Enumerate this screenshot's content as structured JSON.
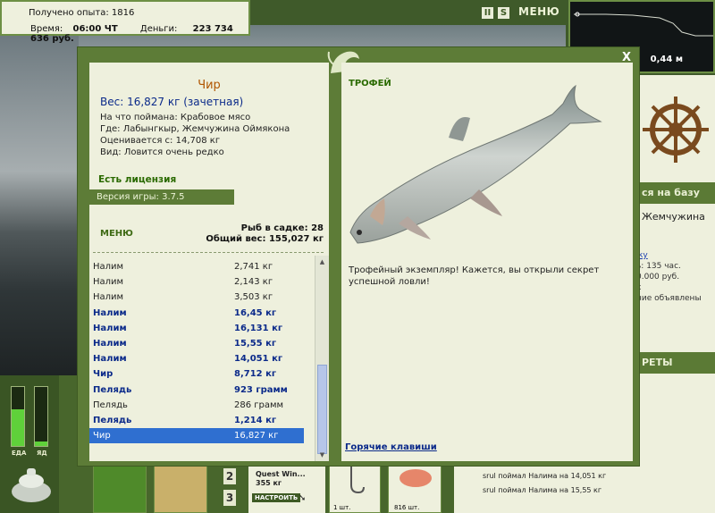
{
  "status": {
    "experience_label": "Получено опыта:",
    "experience_value": "1816",
    "time_label": "Время:",
    "time_value": "06:00 ЧТ",
    "money_label": "Деньги:",
    "money_value": "223 734 636 руб."
  },
  "top": {
    "pause_glyph": "II",
    "s_glyph": "S",
    "menu_label": "МЕНЮ",
    "depth_value": "0,44 м"
  },
  "right_panel": {
    "to_base_label": "ся на базу",
    "place_text": "Жемчужина",
    "info_lines": [
      "ку",
      "ь: 135 час.",
      "0.000 руб.",
      "х",
      "ние объявлены"
    ],
    "secrets_label": "РЕТЫ"
  },
  "bottom": {
    "food_label": "ЕДА",
    "drink_label": "ЯД",
    "slot_numbers": [
      "2",
      "3"
    ],
    "quest_title": "Quest Win...",
    "quest_amount": "355 кг",
    "quest_button": "НАСТРОИТЬ",
    "qty_1": "1 шт.",
    "qty_2": "816 шт.",
    "feed": [
      "srul поймал Налима на 14,051 кг",
      "srul поймал Налима на 15,55 кг"
    ]
  },
  "fish": {
    "name": "Чир",
    "weight_line": "Вес: 16,827 кг (зачетная)",
    "bait_line": "На что поймана: Крабовое мясо",
    "place_line": "Где: Лабынгкыр, Жемчужина Оймякона",
    "value_line": "Оценивается с: 14,708 кг",
    "kind_line": "Вид: Ловится очень редко"
  },
  "license_text": "Есть лицензия",
  "version_text": "Версия игры: 3.7.5",
  "keepnet": {
    "menu_label": "МЕНЮ",
    "count_line": "Рыб в садке: 28",
    "total_line": "Общий вес: 155,027 кг",
    "catches": [
      {
        "name": "Налим",
        "weight": "2,741 кг",
        "style": "normal"
      },
      {
        "name": "Налим",
        "weight": "2,143 кг",
        "style": "normal"
      },
      {
        "name": "Налим",
        "weight": "3,503 кг",
        "style": "normal"
      },
      {
        "name": "Налим",
        "weight": "16,45 кг",
        "style": "bold"
      },
      {
        "name": "Налим",
        "weight": "16,131 кг",
        "style": "bold"
      },
      {
        "name": "Налим",
        "weight": "15,55 кг",
        "style": "bold"
      },
      {
        "name": "Налим",
        "weight": "14,051 кг",
        "style": "bold"
      },
      {
        "name": "Чир",
        "weight": "8,712 кг",
        "style": "bold"
      },
      {
        "name": "Пелядь",
        "weight": "923 грамм",
        "style": "bold"
      },
      {
        "name": "Пелядь",
        "weight": "286 грамм",
        "style": "normal"
      },
      {
        "name": "Пелядь",
        "weight": "1,214 кг",
        "style": "bold"
      },
      {
        "name": "Чир",
        "weight": "16,827 кг",
        "style": "selected"
      }
    ]
  },
  "trophy": {
    "title": "ТРОФЕЙ",
    "text": "Трофейный экземпляр! Кажется, вы открыли секрет успешной ловли!",
    "hotkeys_label": "Горячие клавиши"
  },
  "dialog": {
    "close_glyph": "X"
  },
  "icons": [
    "close-icon",
    "ship-wheel-icon",
    "fish-logo-icon",
    "pot-icon",
    "scroll-up-icon",
    "scroll-down-icon"
  ],
  "colors": {
    "frame_green": "#5d7c37",
    "panel_bg": "#eef0dd",
    "selected_row": "#2f6fd0",
    "name_orange": "#b05500",
    "bold_blue": "#0b2a8a"
  }
}
